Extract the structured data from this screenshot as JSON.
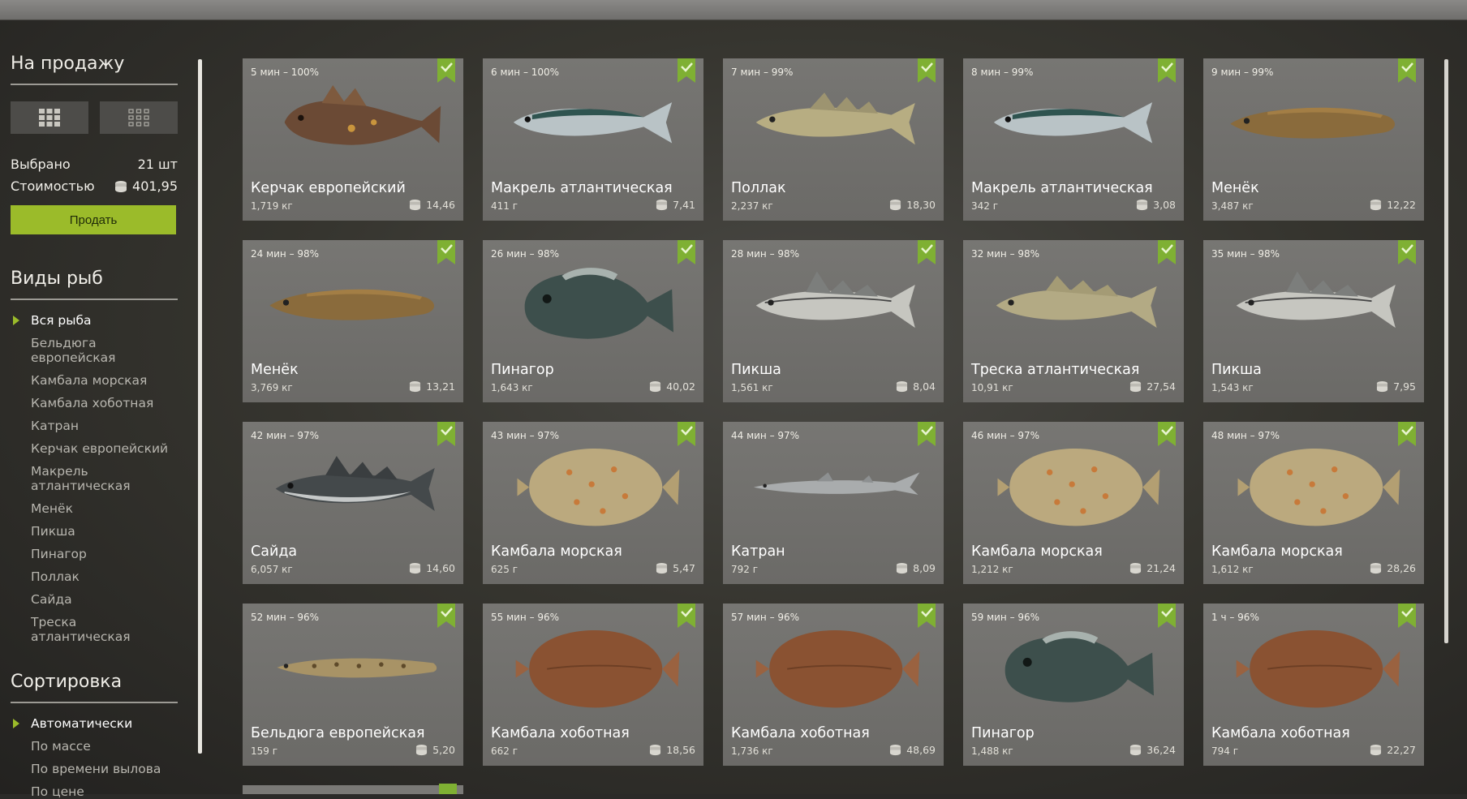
{
  "sidebar": {
    "sale_title": "На продажу",
    "selected_label": "Выбрано",
    "selected_value": "21 шт",
    "cost_label": "Стоимостью",
    "cost_value": "401,95",
    "sell_label": "Продать",
    "species_title": "Виды рыб",
    "species": [
      {
        "label": "Вся рыба",
        "active": true
      },
      {
        "label": "Бельдюга европейская",
        "active": false
      },
      {
        "label": "Камбала морская",
        "active": false
      },
      {
        "label": "Камбала хоботная",
        "active": false
      },
      {
        "label": "Катран",
        "active": false
      },
      {
        "label": "Керчак европейский",
        "active": false
      },
      {
        "label": "Макрель атлантическая",
        "active": false
      },
      {
        "label": "Менёк",
        "active": false
      },
      {
        "label": "Пикша",
        "active": false
      },
      {
        "label": "Пинагор",
        "active": false
      },
      {
        "label": "Поллак",
        "active": false
      },
      {
        "label": "Сайда",
        "active": false
      },
      {
        "label": "Треска атлантическая",
        "active": false
      }
    ],
    "sort_title": "Сортировка",
    "sort_options": [
      {
        "label": "Автоматически",
        "active": true
      },
      {
        "label": "По массе",
        "active": false
      },
      {
        "label": "По времени вылова",
        "active": false
      },
      {
        "label": "По цене",
        "active": false
      }
    ]
  },
  "colors": {
    "accent": "#9bbb2a",
    "check": "#7fb033"
  },
  "cards": [
    {
      "meta": "5 мин – 100%",
      "name": "Керчак европейский",
      "weight": "1,719 кг",
      "price": "14,46",
      "fish": "sculpin"
    },
    {
      "meta": "6 мин – 100%",
      "name": "Макрель атлантическая",
      "weight": "411 г",
      "price": "7,41",
      "fish": "mackerel"
    },
    {
      "meta": "7 мин – 99%",
      "name": "Поллак",
      "weight": "2,237 кг",
      "price": "18,30",
      "fish": "pollack"
    },
    {
      "meta": "8 мин – 99%",
      "name": "Макрель атлантическая",
      "weight": "342 г",
      "price": "3,08",
      "fish": "mackerel"
    },
    {
      "meta": "9 мин – 99%",
      "name": "Менёк",
      "weight": "3,487 кг",
      "price": "12,22",
      "fish": "tusk"
    },
    {
      "meta": "24 мин – 98%",
      "name": "Менёк",
      "weight": "3,769 кг",
      "price": "13,21",
      "fish": "tusk"
    },
    {
      "meta": "26 мин – 98%",
      "name": "Пинагор",
      "weight": "1,643 кг",
      "price": "40,02",
      "fish": "lumpfish"
    },
    {
      "meta": "28 мин – 98%",
      "name": "Пикша",
      "weight": "1,561 кг",
      "price": "8,04",
      "fish": "haddock"
    },
    {
      "meta": "32 мин – 98%",
      "name": "Треска атлантическая",
      "weight": "10,91 кг",
      "price": "27,54",
      "fish": "cod"
    },
    {
      "meta": "35 мин – 98%",
      "name": "Пикша",
      "weight": "1,543 кг",
      "price": "7,95",
      "fish": "haddock"
    },
    {
      "meta": "42 мин – 97%",
      "name": "Сайда",
      "weight": "6,057 кг",
      "price": "14,60",
      "fish": "saithe"
    },
    {
      "meta": "43 мин – 97%",
      "name": "Камбала морская",
      "weight": "625 г",
      "price": "5,47",
      "fish": "plaice"
    },
    {
      "meta": "44 мин – 97%",
      "name": "Катран",
      "weight": "792 г",
      "price": "8,09",
      "fish": "dogfish"
    },
    {
      "meta": "46 мин – 97%",
      "name": "Камбала морская",
      "weight": "1,212 кг",
      "price": "21,24",
      "fish": "plaice"
    },
    {
      "meta": "48 мин – 97%",
      "name": "Камбала морская",
      "weight": "1,612 кг",
      "price": "28,26",
      "fish": "plaice"
    },
    {
      "meta": "52 мин – 96%",
      "name": "Бельдюга европейская",
      "weight": "159 г",
      "price": "5,20",
      "fish": "eelpout"
    },
    {
      "meta": "55 мин – 96%",
      "name": "Камбала хоботная",
      "weight": "662 г",
      "price": "18,56",
      "fish": "dab"
    },
    {
      "meta": "57 мин – 96%",
      "name": "Камбала хоботная",
      "weight": "1,736 кг",
      "price": "48,69",
      "fish": "dab"
    },
    {
      "meta": "59 мин – 96%",
      "name": "Пинагор",
      "weight": "1,488 кг",
      "price": "36,24",
      "fish": "lumpfish"
    },
    {
      "meta": "1 ч – 96%",
      "name": "Камбала хоботная",
      "weight": "794 г",
      "price": "22,27",
      "fish": "dab"
    }
  ]
}
